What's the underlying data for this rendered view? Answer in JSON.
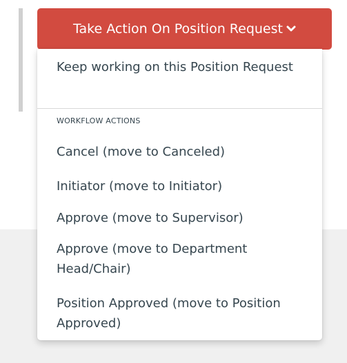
{
  "action_button": {
    "label": "Take Action On Position Request",
    "icon": "chevron-down-icon",
    "color": "#d24b40"
  },
  "menu": {
    "keep_working": "Keep working on this Position Request",
    "section_header": "WORKFLOW ACTIONS",
    "items": [
      {
        "label": "Cancel (move to Canceled)"
      },
      {
        "label": "Initiator (move to Initiator)"
      },
      {
        "label": "Approve (move to Supervisor)"
      },
      {
        "label": "Approve (move to Department Head/Chair)"
      },
      {
        "label": "Position Approved (move to Position Approved)"
      }
    ]
  }
}
